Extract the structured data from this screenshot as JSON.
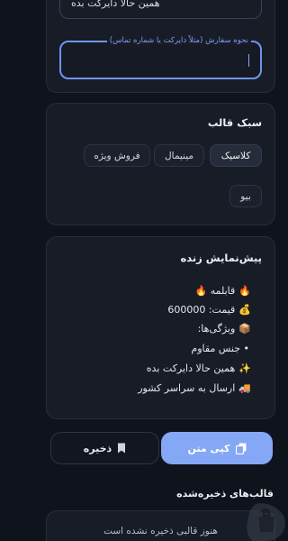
{
  "form": {
    "previous_field_value": "همین حالا دایرکت بده",
    "order_field_label": "نحوه سفارش (مثلاً دایرکت یا شماره تماس)",
    "order_field_value": ""
  },
  "style_section": {
    "title": "سبک قالب",
    "options": [
      "کلاسیک",
      "مینیمال",
      "فروش ویژه",
      "بیو"
    ],
    "selected": "کلاسیک"
  },
  "preview": {
    "title": "پیش‌نمایش زنده",
    "lines": [
      {
        "emoji": "🔥",
        "text": "قابلمه",
        "trail_emoji": "🔥"
      },
      {
        "emoji": "💰",
        "text": "قیمت: 600000"
      },
      {
        "emoji": "📦",
        "text": "ویژگی‌ها:"
      },
      {
        "emoji": "",
        "text": "• جنس مقاوم"
      },
      {
        "emoji": "✨",
        "text": "همین حالا دایرکت بده"
      },
      {
        "emoji": "🚚",
        "text": "ارسال به سراسر کشور"
      }
    ]
  },
  "actions": {
    "copy_label": "کپی متن",
    "save_label": "ذخیره",
    "copy_icon": "copy-icon",
    "save_icon": "bookmark-icon"
  },
  "saved_section": {
    "title": "قالب‌های ذخیره‌شده",
    "empty_text": "هنوز قالبی ذخیره نشده است"
  },
  "colors": {
    "background": "#0f131b",
    "card": "#171c27",
    "accent": "#84a8f5",
    "focus_border": "#6f95f2"
  }
}
